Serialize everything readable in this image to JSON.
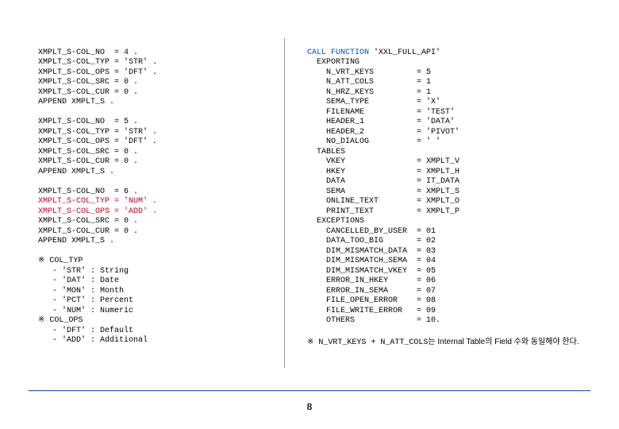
{
  "left": {
    "b1": "XMPLT_S-COL_NO  = 4 .\nXMPLT_S-COL_TYP = 'STR' .\nXMPLT_S-COL_OPS = 'DFT' .\nXMPLT_S-COL_SRC = 0 .\nXMPLT_S-COL_CUR = 0 .\nAPPEND XMPLT_S .",
    "b2": "XMPLT_S-COL_NO  = 5 .\nXMPLT_S-COL_TYP = 'STR' .\nXMPLT_S-COL_OPS = 'DFT' .\nXMPLT_S-COL_SRC = 0 .\nXMPLT_S-COL_CUR = 0 .\nAPPEND XMPLT_S .",
    "b3": "XMPLT_S-COL_NO  = 6 .",
    "b3b": "XMPLT_S-COL_TYP = 'NUM' .\nXMPLT_S-COL_OPS = 'ADD' .",
    "b3c": "XMPLT_S-COL_SRC = 0 .\nXMPLT_S-COL_CUR = 0 .\nAPPEND XMPLT_S .",
    "c1h": "※ COL_TYP",
    "c1": "   - 'STR' : String\n   - 'DAT' : Date\n   - 'MON' : Month\n   - 'PCT' : Percent\n   - 'NUM' : Numeric",
    "c2h": "※ COL_OPS",
    "c2": "   - 'DFT' : Default\n   - 'ADD' : Additional"
  },
  "right": {
    "h1": "CALL FUNCTION ",
    "h1s": "'XXL_FULL_API'",
    "exp": "  EXPORTING\n    N_VRT_KEYS         = 5\n    N_ATT_COLS         = 1\n    N_HRZ_KEYS         = 1\n    SEMA_TYPE          = 'X'\n    FILENAME           = 'TEST'\n    HEADER_1           = 'DATA'\n    HEADER_2           = 'PIVOT'\n    NO_DIALOG          = ' '",
    "tab": "  TABLES\n    VKEY               = XMPLT_V\n    HKEY               = XMPLT_H\n    DATA               = IT_DATA\n    SEMA               = XMPLT_S\n    ONLINE_TEXT        = XMPLT_O\n    PRINT_TEXT         = XMPLT_P",
    "exc": "  EXCEPTIONS\n    CANCELLED_BY_USER  = 01\n    DATA_TOO_BIG       = 02\n    DIM_MISMATCH_DATA  = 03\n    DIM_MISMATCH_SEMA  = 04\n    DIM_MISMATCH_VKEY  = 05\n    ERROR_IN_HKEY      = 06\n    ERROR_IN_SEMA      = 07\n    FILE_OPEN_ERROR    = 08\n    FILE_WRITE_ERROR   = 09\n    OTHERS             = 10.",
    "note_pre": "※ N_VRT_KEYS + N_ATT_COLS",
    "note_post": "는 Internal Table의 Field 수와 동일해야 한다."
  },
  "page": "8"
}
